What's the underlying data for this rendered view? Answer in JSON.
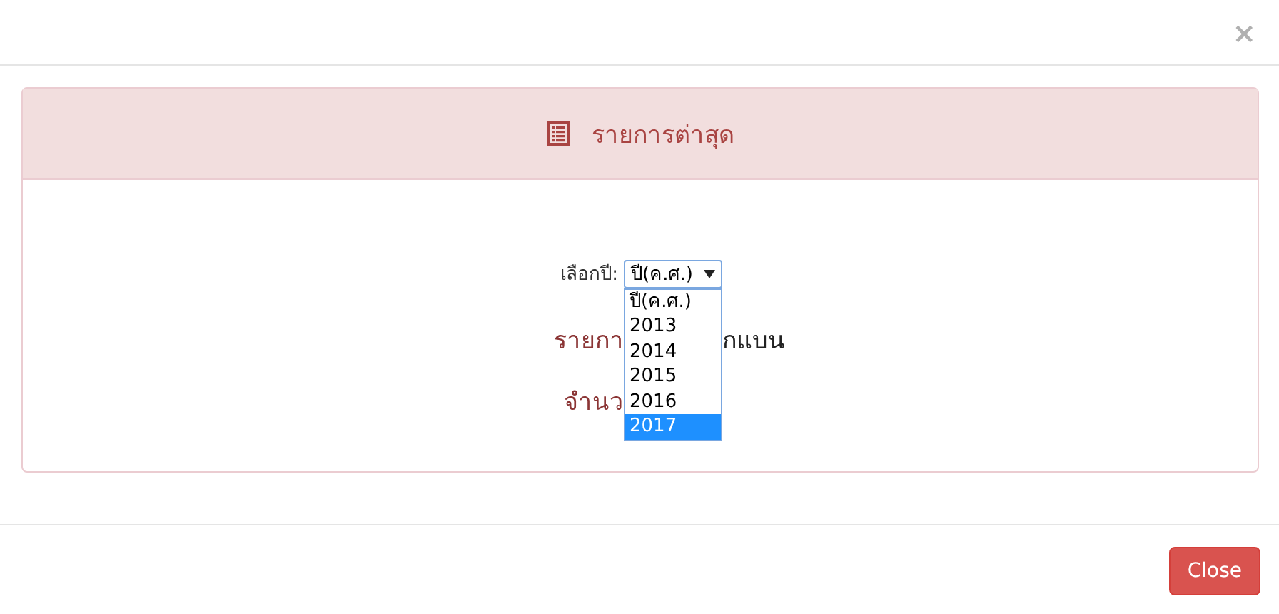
{
  "modal": {
    "close_glyph": "×"
  },
  "panel": {
    "title": "รายการต่าสุด"
  },
  "year_select": {
    "label": "เลือกปี:",
    "value": "ปี(ค.ศ.)",
    "expanded": true,
    "options": [
      {
        "label": "ปี(ค.ศ.)",
        "highlighted": false
      },
      {
        "label": "2013",
        "highlighted": false
      },
      {
        "label": "2014",
        "highlighted": false
      },
      {
        "label": "2015",
        "highlighted": false
      },
      {
        "label": "2016",
        "highlighted": false
      },
      {
        "label": "2017",
        "highlighted": true
      }
    ]
  },
  "partly_hidden_lines": [
    {
      "parts": [
        "รายกา",
        "กแบน"
      ]
    },
    {
      "parts": [
        "จำนว"
      ]
    }
  ],
  "footer": {
    "buttons": [
      "Close"
    ]
  }
}
